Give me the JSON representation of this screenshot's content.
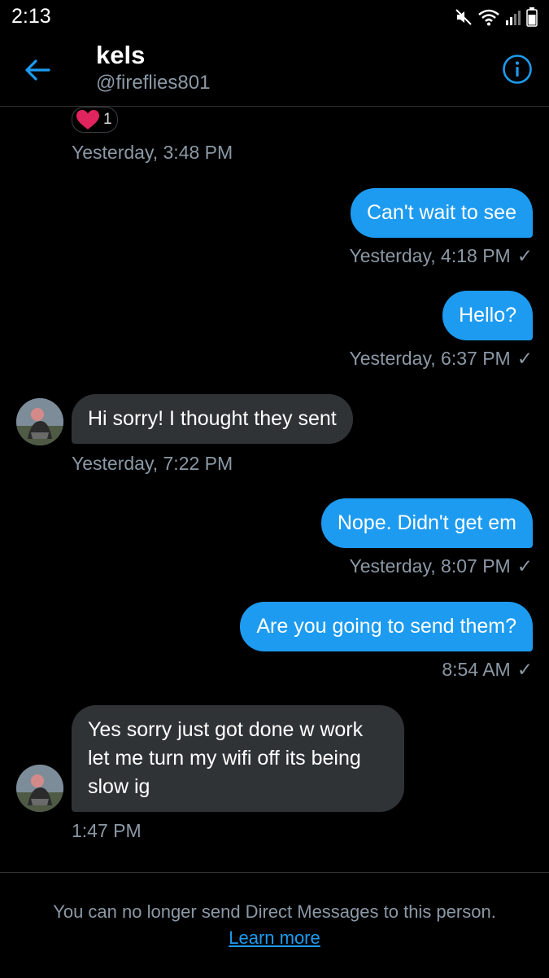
{
  "status_bar": {
    "time": "2:13"
  },
  "header": {
    "name": "kels",
    "handle": "@fireflies801"
  },
  "reaction": {
    "emoji": "heart",
    "count": "1"
  },
  "messages": [
    {
      "timestamp": "Yesterday, 3:48 PM"
    },
    {
      "text": "Can't wait to see",
      "timestamp": "Yesterday, 4:18 PM"
    },
    {
      "text": "Hello?",
      "timestamp": "Yesterday, 6:37 PM"
    },
    {
      "text": "Hi sorry! I thought they sent",
      "timestamp": "Yesterday, 7:22 PM"
    },
    {
      "text": "Nope. Didn't get em",
      "timestamp": "Yesterday, 8:07 PM"
    },
    {
      "text": "Are you going to send them?",
      "timestamp": "8:54 AM"
    },
    {
      "text": "Yes sorry just got done w work let me turn my wifi off its being slow ig",
      "timestamp": "1:47 PM"
    }
  ],
  "footer": {
    "notice": "You can no longer send Direct Messages to this person.",
    "link": "Learn more"
  },
  "colors": {
    "accent": "#1d9bf0",
    "incoming_bubble": "#2f3336",
    "muted_text": "#8b98a5",
    "heart": "#e0245e"
  }
}
